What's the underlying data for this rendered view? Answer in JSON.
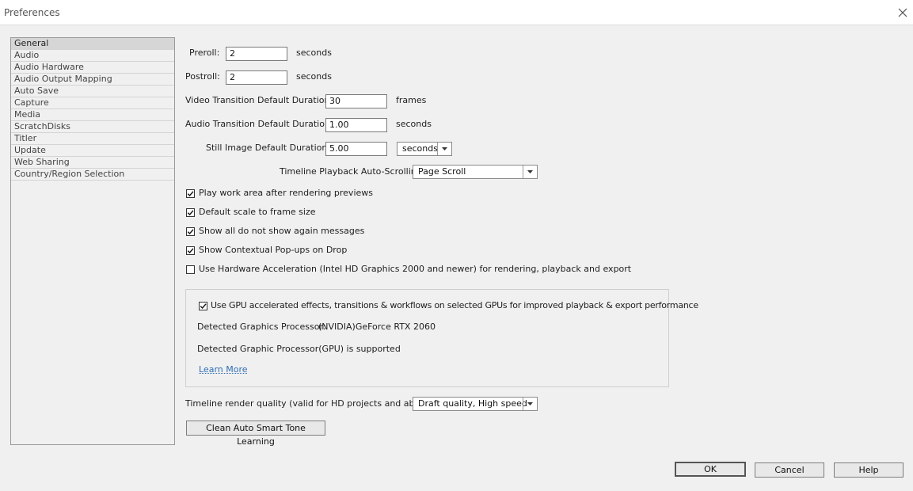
{
  "window": {
    "title": "Preferences"
  },
  "sidebar": {
    "items": [
      {
        "label": "General",
        "selected": true
      },
      {
        "label": "Audio"
      },
      {
        "label": "Audio Hardware"
      },
      {
        "label": "Audio Output Mapping"
      },
      {
        "label": "Auto Save"
      },
      {
        "label": "Capture"
      },
      {
        "label": "Media"
      },
      {
        "label": "ScratchDisks"
      },
      {
        "label": "Titler"
      },
      {
        "label": "Update"
      },
      {
        "label": "Web Sharing"
      },
      {
        "label": "Country/Region Selection"
      }
    ]
  },
  "general": {
    "preroll": {
      "label": "Preroll:",
      "value": "2",
      "unit": "seconds"
    },
    "postroll": {
      "label": "Postroll:",
      "value": "2",
      "unit": "seconds"
    },
    "video_transition": {
      "label": "Video Transition Default Duration:",
      "value": "30",
      "unit": "frames"
    },
    "audio_transition": {
      "label": "Audio Transition Default Duration:",
      "value": "1.00",
      "unit": "seconds"
    },
    "still_image": {
      "label": "Still Image Default Duration:",
      "value": "5.00",
      "unit_selected": "seconds"
    },
    "timeline_scroll": {
      "label": "Timeline Playback Auto-Scrolling:",
      "selected": "Page Scroll"
    },
    "checkboxes": [
      {
        "label": "Play work area after rendering previews",
        "checked": true
      },
      {
        "label": "Default scale to frame size",
        "checked": true
      },
      {
        "label": "Show all do not show again messages",
        "checked": true
      },
      {
        "label": "Show Contextual Pop-ups on Drop",
        "checked": true
      },
      {
        "label": "Use Hardware Acceleration (Intel HD Graphics 2000 and newer) for rendering, playback and export",
        "checked": false
      }
    ],
    "gpu": {
      "checkbox_label": "Use GPU accelerated effects, transitions & workflows on selected GPUs for improved playback & export performance",
      "checked": true,
      "detected_label": "Detected Graphics Processor:",
      "detected_value": "(NVIDIA)GeForce RTX 2060",
      "supported_text": "Detected Graphic Processor(GPU) is supported",
      "learn_more": "Learn More"
    },
    "render_quality": {
      "label": "Timeline render quality (valid for HD projects and above):",
      "selected": "Draft quality, High speed"
    },
    "clean_button": "Clean Auto Smart Tone Learning"
  },
  "footer": {
    "ok": "OK",
    "cancel": "Cancel",
    "help": "Help"
  },
  "colors": {
    "link": "#2f6fb5",
    "background": "#f0f0f0"
  }
}
